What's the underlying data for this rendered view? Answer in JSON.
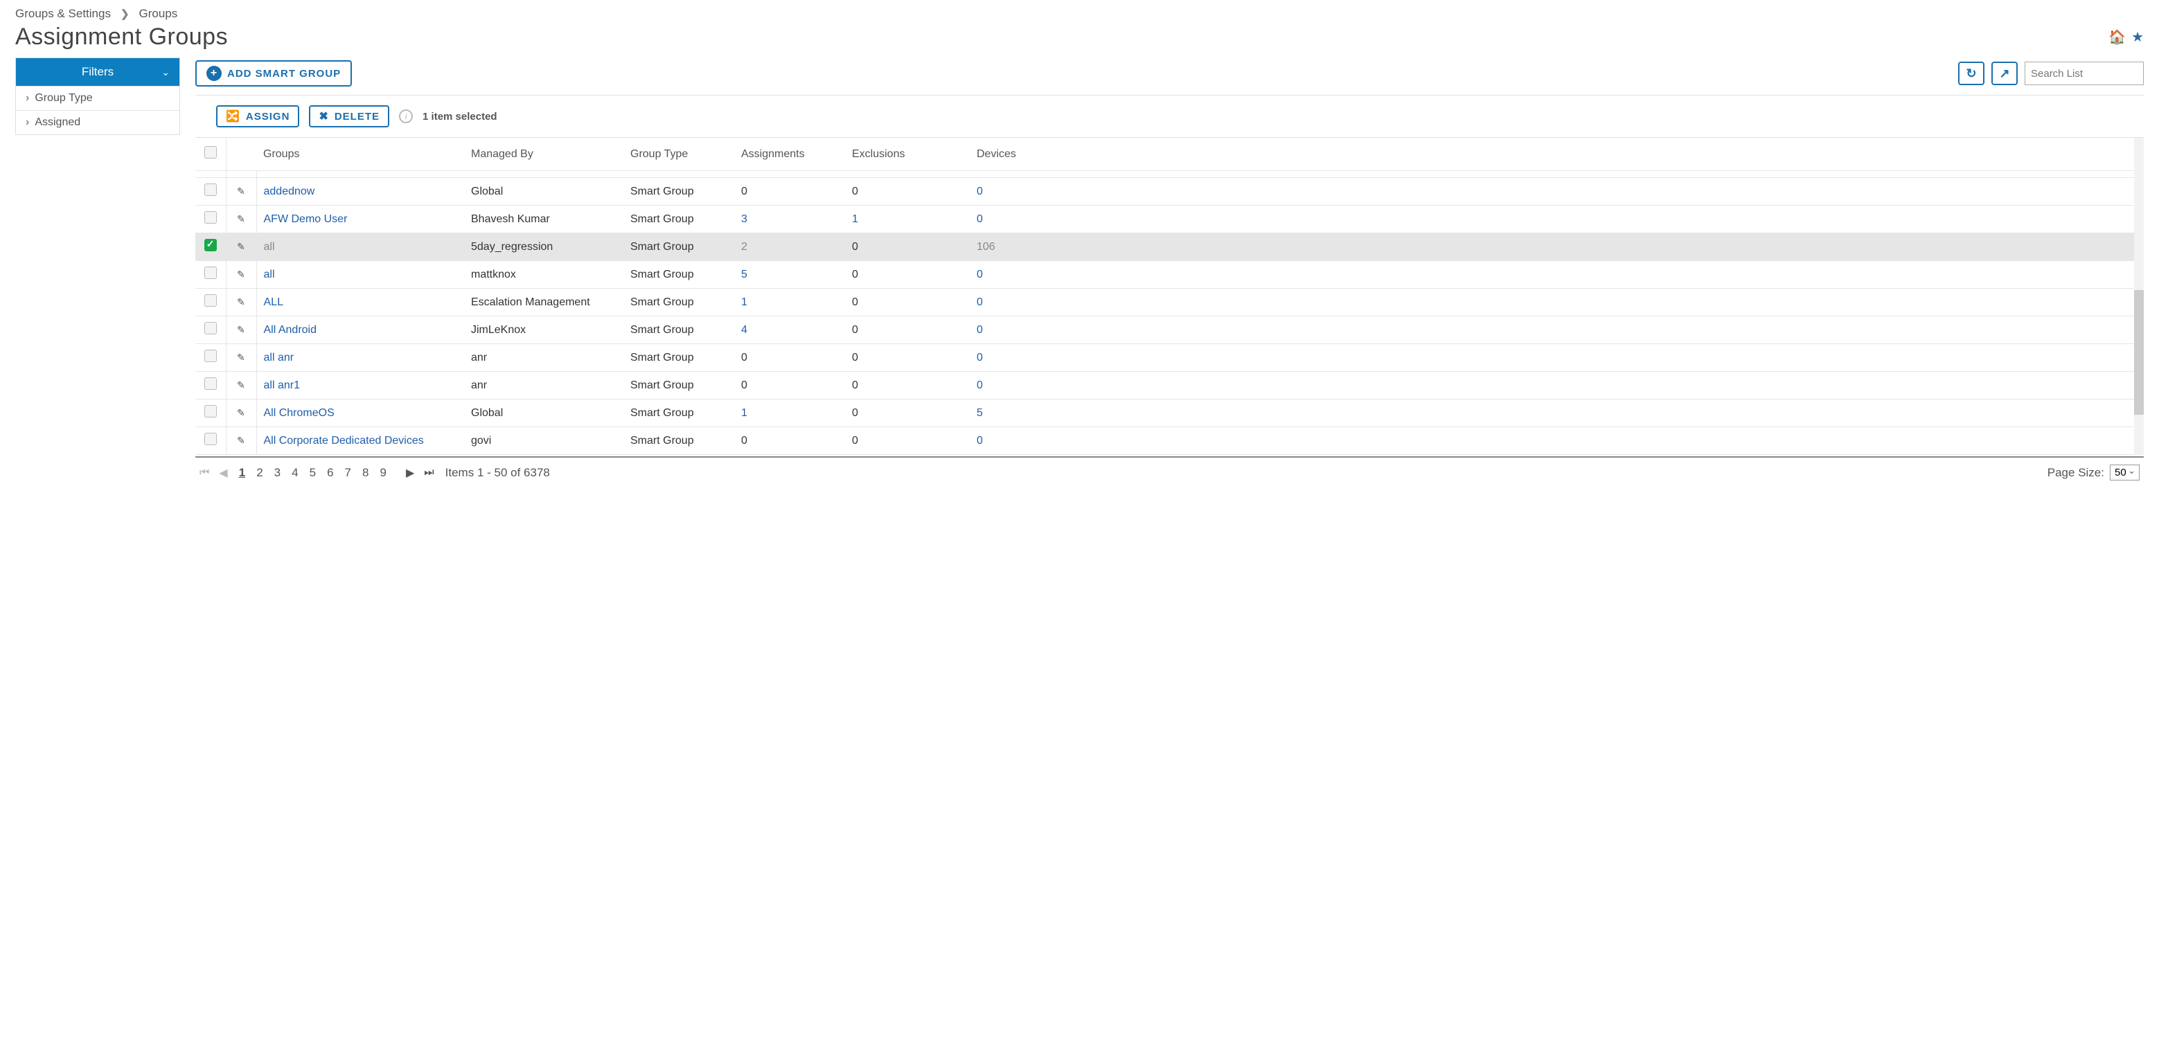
{
  "breadcrumb": {
    "root": "Groups & Settings",
    "leaf": "Groups"
  },
  "page_title": "Assignment Groups",
  "sidebar": {
    "header": "Filters",
    "items": [
      {
        "label": "Group Type"
      },
      {
        "label": "Assigned"
      }
    ]
  },
  "toolbar": {
    "add_smart_group": "ADD SMART GROUP",
    "search_placeholder": "Search List"
  },
  "actions": {
    "assign": "ASSIGN",
    "delete": "DELETE",
    "selected_text": "1 item selected"
  },
  "columns": {
    "groups": "Groups",
    "managed_by": "Managed By",
    "group_type": "Group Type",
    "assignments": "Assignments",
    "exclusions": "Exclusions",
    "devices": "Devices"
  },
  "rows": [
    {
      "checked": false,
      "name": "addednow",
      "managed_by": "Global",
      "type": "Smart Group",
      "assignments": "0",
      "exclusions": "0",
      "devices": "0",
      "assignments_link": false
    },
    {
      "checked": false,
      "name": "AFW Demo User",
      "managed_by": "Bhavesh Kumar",
      "type": "Smart Group",
      "assignments": "3",
      "exclusions": "1",
      "devices": "0",
      "assignments_link": true,
      "exclusions_link": true
    },
    {
      "checked": true,
      "name": "all",
      "managed_by": "5day_regression",
      "type": "Smart Group",
      "assignments": "2",
      "exclusions": "0",
      "devices": "106",
      "assignments_link": true
    },
    {
      "checked": false,
      "name": "all",
      "managed_by": "mattknox",
      "type": "Smart Group",
      "assignments": "5",
      "exclusions": "0",
      "devices": "0",
      "assignments_link": true
    },
    {
      "checked": false,
      "name": "ALL",
      "managed_by": "Escalation Management",
      "type": "Smart Group",
      "assignments": "1",
      "exclusions": "0",
      "devices": "0",
      "assignments_link": true
    },
    {
      "checked": false,
      "name": "All Android",
      "managed_by": "JimLeKnox",
      "type": "Smart Group",
      "assignments": "4",
      "exclusions": "0",
      "devices": "0",
      "assignments_link": true
    },
    {
      "checked": false,
      "name": "all anr",
      "managed_by": "anr",
      "type": "Smart Group",
      "assignments": "0",
      "exclusions": "0",
      "devices": "0",
      "assignments_link": false
    },
    {
      "checked": false,
      "name": "all anr1",
      "managed_by": "anr",
      "type": "Smart Group",
      "assignments": "0",
      "exclusions": "0",
      "devices": "0",
      "assignments_link": false
    },
    {
      "checked": false,
      "name": "All ChromeOS",
      "managed_by": "Global",
      "type": "Smart Group",
      "assignments": "1",
      "exclusions": "0",
      "devices": "5",
      "assignments_link": true
    },
    {
      "checked": false,
      "name": "All Corporate Dedicated Devices",
      "managed_by": "govi",
      "type": "Smart Group",
      "assignments": "0",
      "exclusions": "0",
      "devices": "0",
      "assignments_link": false
    }
  ],
  "pagination": {
    "pages": [
      "1",
      "2",
      "3",
      "4",
      "5",
      "6",
      "7",
      "8",
      "9"
    ],
    "current": "1",
    "info": "Items 1 - 50 of 6378",
    "page_size_label": "Page Size:",
    "page_size_value": "50"
  }
}
